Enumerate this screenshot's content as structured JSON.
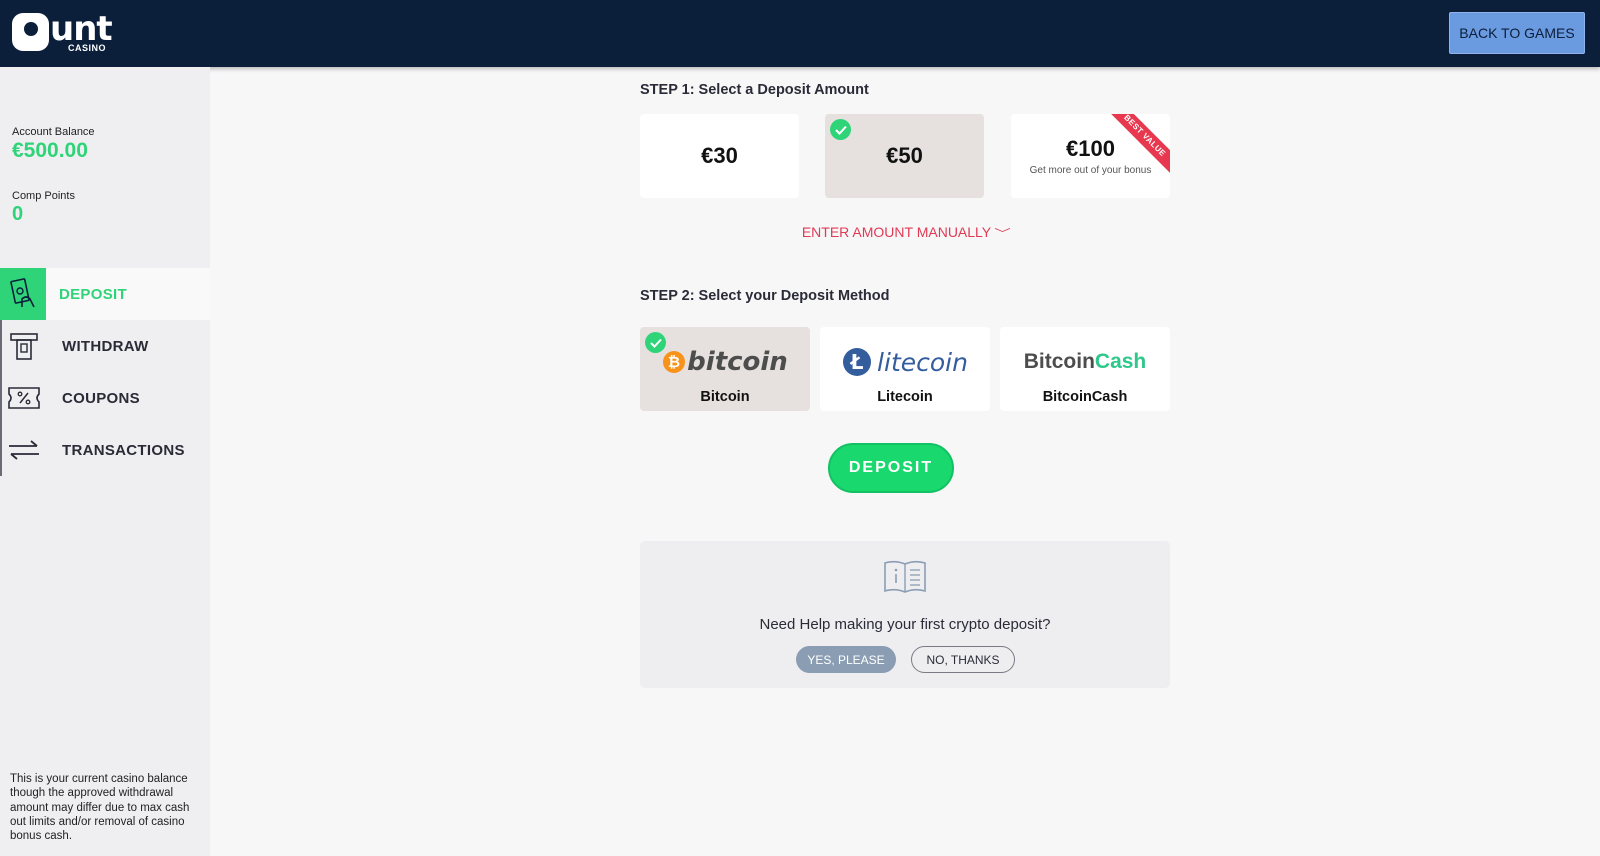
{
  "header": {
    "logo_text": "unt",
    "logo_sub": "CASINO",
    "back_label": "BACK TO GAMES"
  },
  "sidebar": {
    "balance_label": "Account Balance",
    "balance_value": "€500.00",
    "comp_label": "Comp Points",
    "comp_value": "0",
    "items": [
      {
        "label": "DEPOSIT",
        "icon": "cash-hand-icon",
        "active": true
      },
      {
        "label": "WITHDRAW",
        "icon": "atm-icon",
        "active": false
      },
      {
        "label": "COUPONS",
        "icon": "coupon-icon",
        "active": false
      },
      {
        "label": "TRANSACTIONS",
        "icon": "arrows-exchange-icon",
        "active": false
      }
    ],
    "footnote": "This is your current casino balance though the approved withdrawal amount may differ due to max cash out limits and/or removal of casino bonus cash."
  },
  "step1": {
    "title": "STEP 1: Select a Deposit Amount",
    "amounts": [
      {
        "value": "€30",
        "sub": "",
        "selected": false
      },
      {
        "value": "€50",
        "sub": "",
        "selected": true
      },
      {
        "value": "€100",
        "sub": "Get more out of your bonus",
        "selected": false,
        "ribbon": "BEST VALUE"
      }
    ],
    "manual_label": "ENTER AMOUNT MANUALLY"
  },
  "step2": {
    "title": "STEP 2: Select your Deposit Method",
    "methods": [
      {
        "name": "Bitcoin",
        "logo_text": "bitcoin",
        "selected": true
      },
      {
        "name": "Litecoin",
        "logo_text": "litecoin",
        "selected": false
      },
      {
        "name": "BitcoinCash",
        "logo_text_a": "Bitcoin",
        "logo_text_b": "Cash",
        "selected": false
      }
    ]
  },
  "deposit_label": "DEPOSIT",
  "help": {
    "text": "Need Help making your first crypto deposit?",
    "yes_label": "YES, PLEASE",
    "no_label": "NO, THANKS"
  },
  "colors": {
    "accent_green": "#2fd479",
    "header_navy": "#0b1f3b",
    "link_red": "#e03a55",
    "back_button_blue": "#6a9ae0"
  }
}
